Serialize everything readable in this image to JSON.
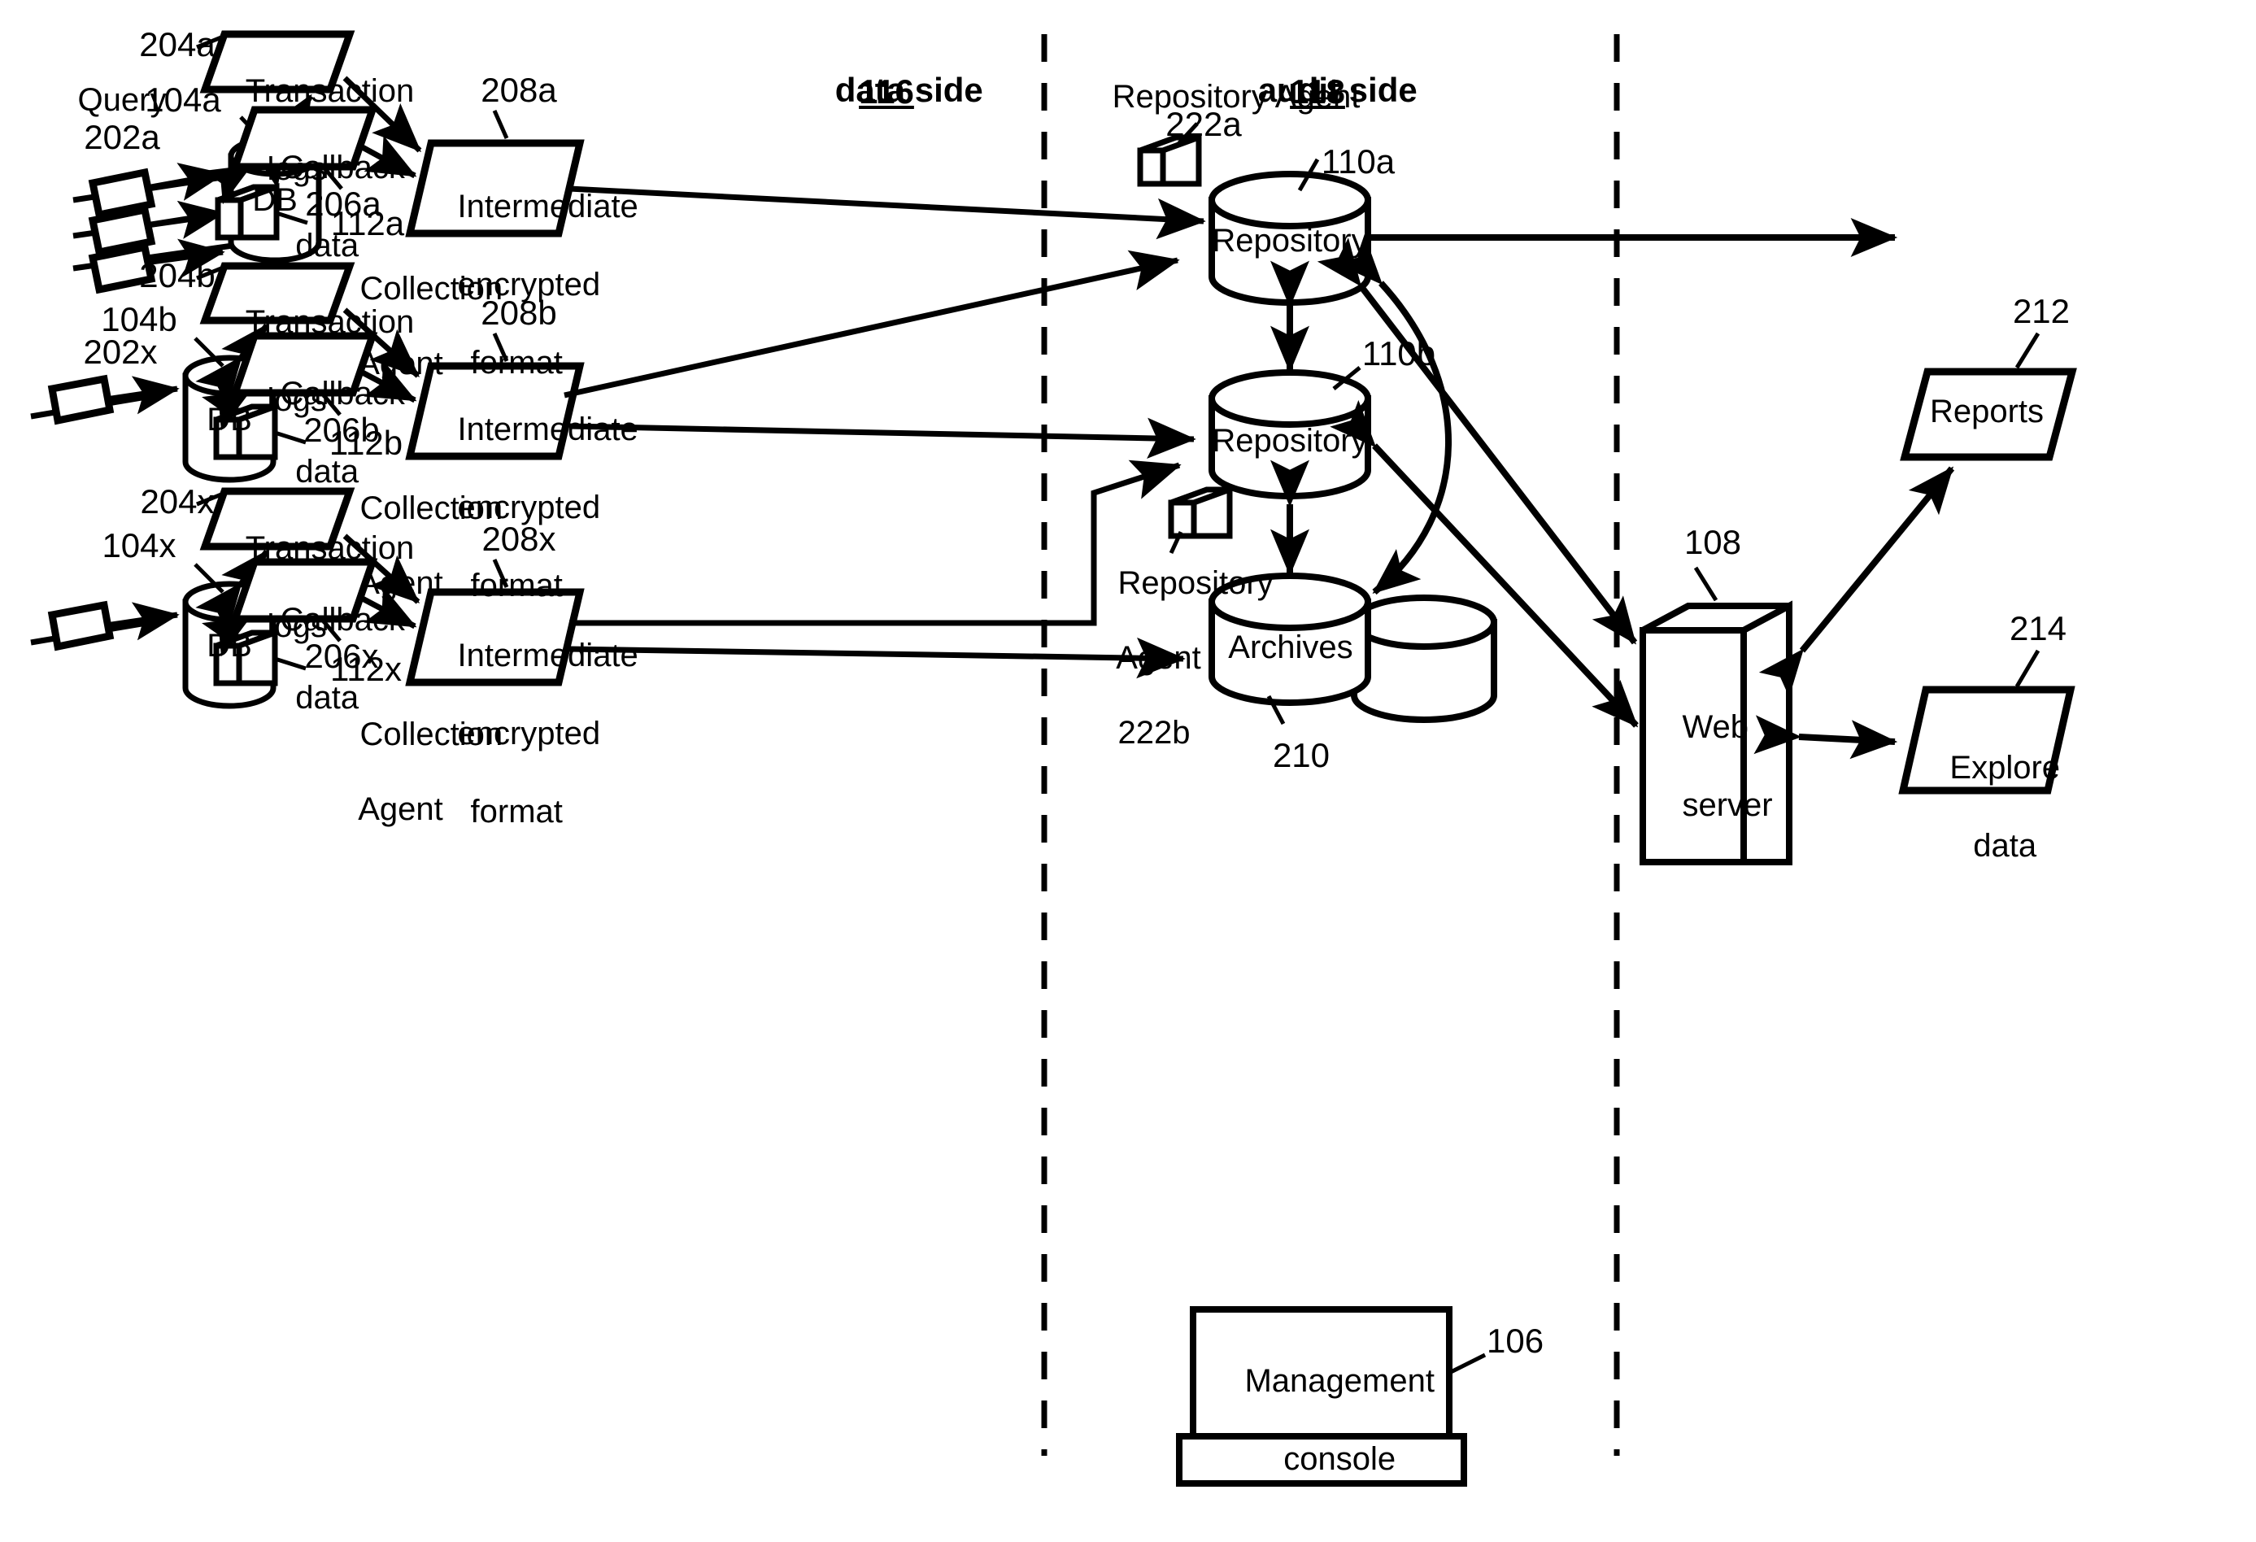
{
  "figure": {
    "title": "Database auditing architecture diagram",
    "stroke_color": "#000000",
    "background_color": "#ffffff"
  },
  "dividers": {
    "data_side": {
      "label": "data side",
      "number": "116"
    },
    "audit_side": {
      "label": "audit side",
      "number": "118"
    }
  },
  "query_group": {
    "label_line1": "Query",
    "label_line2": "202a",
    "label_last": "202x"
  },
  "rows": [
    {
      "db_label": "DB",
      "db_ref": "104a",
      "agent_ref": "112a",
      "transaction_logs_label_line1": "Transaction",
      "transaction_logs_label_line2": "logs",
      "transaction_logs_ref": "204a",
      "callback_label_line1": "Callback",
      "callback_label_line2": "data",
      "callback_ref": "206a",
      "intermediate_line1": "Intermediate",
      "intermediate_line2": "encrypted",
      "intermediate_line3": "format",
      "intermediate_ref": "208a",
      "collection_agent_line1": "Collection",
      "collection_agent_line2": "Agent"
    },
    {
      "db_label": "DB",
      "db_ref": "104b",
      "agent_ref": "112b",
      "transaction_logs_label_line1": "Transaction",
      "transaction_logs_label_line2": "logs",
      "transaction_logs_ref": "204b",
      "callback_label_line1": "Callback",
      "callback_label_line2": "data",
      "callback_ref": "206b",
      "intermediate_line1": "Intermediate",
      "intermediate_line2": "encrypted",
      "intermediate_line3": "format",
      "intermediate_ref": "208b",
      "collection_agent_line1": "Collection",
      "collection_agent_line2": "Agent"
    },
    {
      "db_label": "DB",
      "db_ref": "104x",
      "agent_ref": "112x",
      "transaction_logs_label_line1": "Transaction",
      "transaction_logs_label_line2": "logs",
      "transaction_logs_ref": "204x",
      "callback_label_line1": "Callback",
      "callback_label_line2": "data",
      "callback_ref": "206x",
      "intermediate_line1": "Intermediate",
      "intermediate_line2": "encrypted",
      "intermediate_line3": "format",
      "intermediate_ref": "208x",
      "collection_agent_line1": "Collection",
      "collection_agent_line2": "Agent"
    }
  ],
  "audit": {
    "repository_agent_a": {
      "line1": "Repository Agent",
      "line2": "222a"
    },
    "repository_agent_b": {
      "line1": "Repository",
      "line2": "Agent",
      "line3": "222b"
    },
    "repository_a": {
      "label": "Repository",
      "ref": "110a"
    },
    "repository_b": {
      "label": "Repository",
      "ref": "110b"
    },
    "archives": {
      "label": "Archives",
      "ref": "210"
    },
    "management_console": {
      "line1": "Management",
      "line2": "console",
      "ref": "106"
    }
  },
  "presentation": {
    "web_server": {
      "line1": "Web",
      "line2": "server",
      "ref": "108"
    },
    "reports": {
      "label": "Reports",
      "ref": "212"
    },
    "explore_data": {
      "line1": "Explore",
      "line2": "data",
      "ref": "214"
    }
  }
}
